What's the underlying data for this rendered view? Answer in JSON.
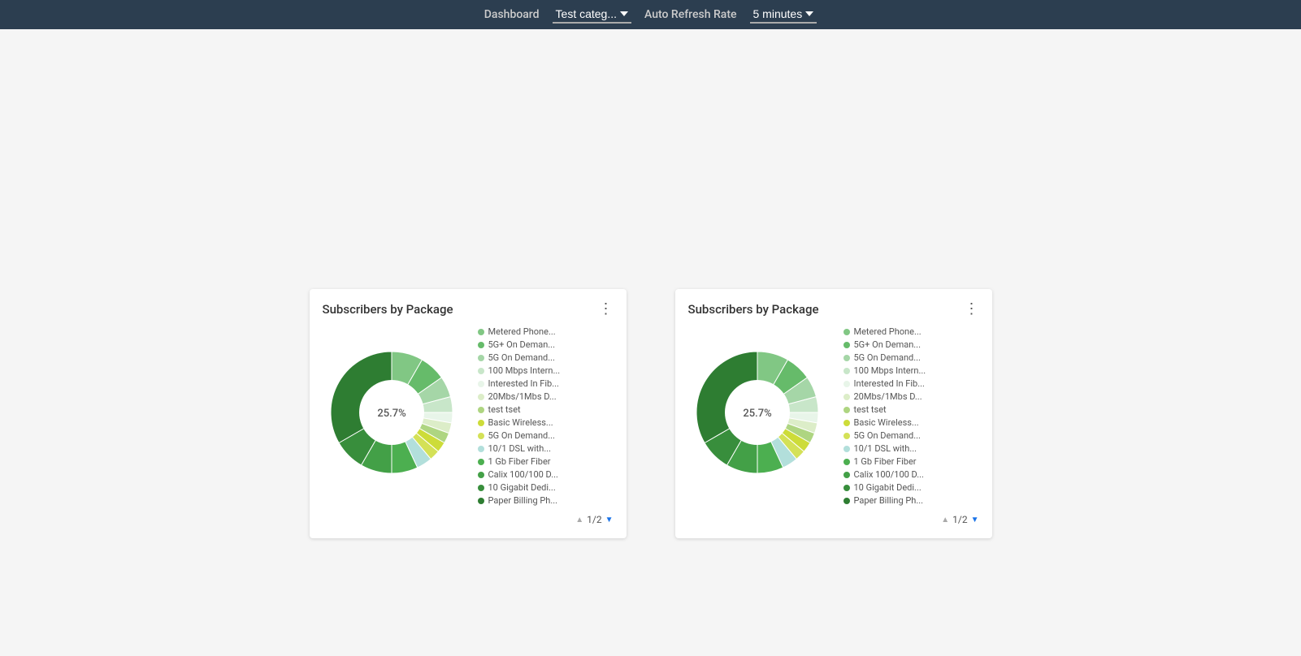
{
  "topbar": {
    "dashboard_label": "Dashboard",
    "category_label": "Test categ...",
    "category_dropdown_icon": "▼",
    "refresh_label": "Auto Refresh Rate",
    "refresh_value": "5 minutes",
    "refresh_dropdown_icon": "▼"
  },
  "charts": [
    {
      "id": "chart1",
      "title": "Subscribers by Package",
      "center_value": "25.7%",
      "pagination": "1/2",
      "legend_items": [
        {
          "label": "Metered Phone...",
          "color": "#81c784"
        },
        {
          "label": "5G+ On Deman...",
          "color": "#66bb6a"
        },
        {
          "label": "5G On Demand...",
          "color": "#a5d6a7"
        },
        {
          "label": "100 Mbps Intern...",
          "color": "#c8e6c9"
        },
        {
          "label": "Interested In Fib...",
          "color": "#e8f5e9"
        },
        {
          "label": "20Mbs/1Mbs D...",
          "color": "#dcedc8"
        },
        {
          "label": "test tset",
          "color": "#aed581"
        },
        {
          "label": "Basic Wireless...",
          "color": "#cddc39"
        },
        {
          "label": "5G On Demand...",
          "color": "#d4e157"
        },
        {
          "label": "10/1 DSL with...",
          "color": "#b2dfdb"
        },
        {
          "label": "1 Gb Fiber Fiber",
          "color": "#4caf50"
        },
        {
          "label": "Calix 100/100 D...",
          "color": "#43a047"
        },
        {
          "label": "10 Gigabit Dedi...",
          "color": "#388e3c"
        },
        {
          "label": "Paper Billing Ph...",
          "color": "#2e7d32"
        }
      ],
      "pie_slices": [
        {
          "color": "#81c784",
          "start": 0,
          "end": 30
        },
        {
          "color": "#66bb6a",
          "start": 30,
          "end": 55
        },
        {
          "color": "#a5d6a7",
          "start": 55,
          "end": 75
        },
        {
          "color": "#c8e6c9",
          "start": 75,
          "end": 90
        },
        {
          "color": "#e8f5e9",
          "start": 90,
          "end": 100
        },
        {
          "color": "#dcedc8",
          "start": 100,
          "end": 110
        },
        {
          "color": "#aed581",
          "start": 110,
          "end": 120
        },
        {
          "color": "#cddc39",
          "start": 120,
          "end": 130
        },
        {
          "color": "#d4e157",
          "start": 130,
          "end": 140
        },
        {
          "color": "#b2dfdb",
          "start": 140,
          "end": 155
        },
        {
          "color": "#4caf50",
          "start": 155,
          "end": 180
        },
        {
          "color": "#43a047",
          "start": 180,
          "end": 210
        },
        {
          "color": "#388e3c",
          "start": 210,
          "end": 240
        },
        {
          "color": "#2e7d32",
          "start": 240,
          "end": 360
        }
      ]
    },
    {
      "id": "chart2",
      "title": "Subscribers by Package",
      "center_value": "25.7%",
      "pagination": "1/2",
      "legend_items": [
        {
          "label": "Metered Phone...",
          "color": "#81c784"
        },
        {
          "label": "5G+ On Deman...",
          "color": "#66bb6a"
        },
        {
          "label": "5G On Demand...",
          "color": "#a5d6a7"
        },
        {
          "label": "100 Mbps Intern...",
          "color": "#c8e6c9"
        },
        {
          "label": "Interested In Fib...",
          "color": "#e8f5e9"
        },
        {
          "label": "20Mbs/1Mbs D...",
          "color": "#dcedc8"
        },
        {
          "label": "test tset",
          "color": "#aed581"
        },
        {
          "label": "Basic Wireless...",
          "color": "#cddc39"
        },
        {
          "label": "5G On Demand...",
          "color": "#d4e157"
        },
        {
          "label": "10/1 DSL with...",
          "color": "#b2dfdb"
        },
        {
          "label": "1 Gb Fiber Fiber",
          "color": "#4caf50"
        },
        {
          "label": "Calix 100/100 D...",
          "color": "#43a047"
        },
        {
          "label": "10 Gigabit Dedi...",
          "color": "#388e3c"
        },
        {
          "label": "Paper Billing Ph...",
          "color": "#2e7d32"
        }
      ],
      "pie_slices": [
        {
          "color": "#81c784",
          "start": 0,
          "end": 30
        },
        {
          "color": "#66bb6a",
          "start": 30,
          "end": 55
        },
        {
          "color": "#a5d6a7",
          "start": 55,
          "end": 75
        },
        {
          "color": "#c8e6c9",
          "start": 75,
          "end": 90
        },
        {
          "color": "#e8f5e9",
          "start": 90,
          "end": 100
        },
        {
          "color": "#dcedc8",
          "start": 100,
          "end": 110
        },
        {
          "color": "#aed581",
          "start": 110,
          "end": 120
        },
        {
          "color": "#cddc39",
          "start": 120,
          "end": 130
        },
        {
          "color": "#d4e157",
          "start": 130,
          "end": 140
        },
        {
          "color": "#b2dfdb",
          "start": 140,
          "end": 155
        },
        {
          "color": "#4caf50",
          "start": 155,
          "end": 180
        },
        {
          "color": "#43a047",
          "start": 180,
          "end": 210
        },
        {
          "color": "#388e3c",
          "start": 210,
          "end": 240
        },
        {
          "color": "#2e7d32",
          "start": 240,
          "end": 360
        }
      ]
    }
  ]
}
